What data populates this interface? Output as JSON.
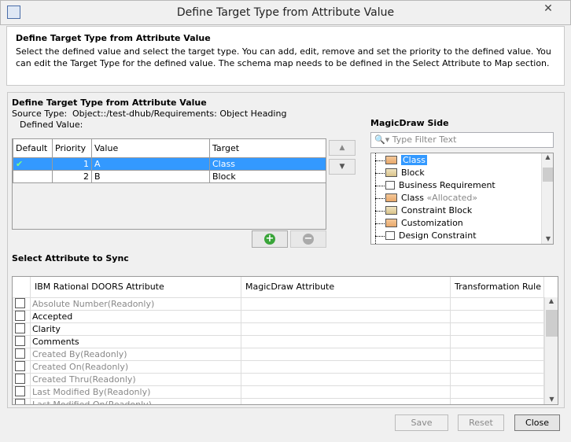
{
  "window": {
    "title": "Define Target Type from Attribute Value",
    "app_icon": "magicdraw-icon",
    "close_icon": "close-icon"
  },
  "header": {
    "title": "Define Target Type from Attribute Value",
    "description": "Select the defined value and select the target type. You can add, edit, remove and set the priority to the defined value. You can edit the Target Type for the defined value. The schema map needs to be defined in the Select Attribute to Map section."
  },
  "section": {
    "title": "Define Target Type from Attribute Value",
    "source_type_label": "Source Type:",
    "source_type_value": "Object::/test-dhub/Requirements: Object Heading",
    "defined_value_label": "Defined Value:"
  },
  "values_table": {
    "columns": [
      "Default",
      "Priority",
      "Value",
      "Target"
    ],
    "rows": [
      {
        "default": true,
        "priority": "1",
        "value": "A",
        "target": "Class",
        "selected": true
      },
      {
        "default": false,
        "priority": "2",
        "value": "B",
        "target": "Block",
        "selected": false
      }
    ]
  },
  "buttons": {
    "up_icon": "arrow-up-icon",
    "down_icon": "arrow-down-icon",
    "add_icon": "plus-icon",
    "remove_icon": "minus-icon",
    "save": "Save",
    "reset": "Reset",
    "close": "Close"
  },
  "magicdraw": {
    "title": "MagicDraw Side",
    "filter_placeholder": "Type Filter Text",
    "items": [
      {
        "label": "Class",
        "selected": true
      },
      {
        "label": "Block"
      },
      {
        "label": "Business Requirement",
        "req": true
      },
      {
        "label": "Class",
        "stereotype": "«Allocated»"
      },
      {
        "label": "Constraint Block"
      },
      {
        "label": "Customization"
      },
      {
        "label": "Design Constraint",
        "req": true
      }
    ]
  },
  "sync": {
    "title": "Select Attribute to Sync",
    "columns": [
      "IBM Rational DOORS Attribute",
      "MagicDraw Attribute",
      "Transformation Rule"
    ],
    "rows": [
      {
        "name": "Absolute Number(Readonly)",
        "readonly": true
      },
      {
        "name": "Accepted"
      },
      {
        "name": "Clarity"
      },
      {
        "name": "Comments"
      },
      {
        "name": "Created By(Readonly)",
        "readonly": true
      },
      {
        "name": "Created On(Readonly)",
        "readonly": true
      },
      {
        "name": "Created Thru(Readonly)",
        "readonly": true
      },
      {
        "name": "Last Modified By(Readonly)",
        "readonly": true
      },
      {
        "name": "Last Modified On(Readonly)",
        "readonly": true
      }
    ]
  },
  "colors": {
    "selection": "#3399ff",
    "check": "#2a9d2a",
    "add": "#3aa53a"
  }
}
